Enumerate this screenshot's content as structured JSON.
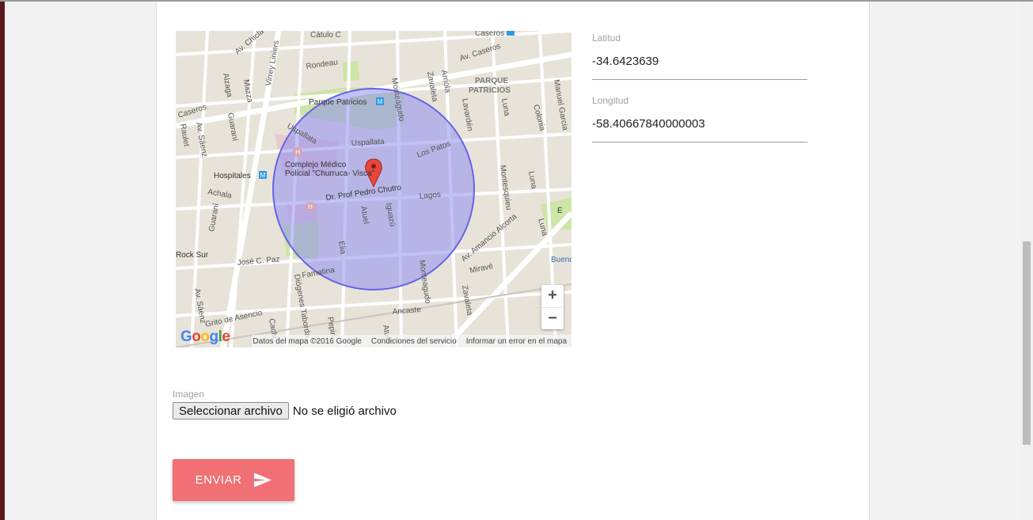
{
  "map": {
    "labels": {
      "caseros_top": "Caseros",
      "av_caseros": "Av. Caseros",
      "caseros_left": "Caseros",
      "parque_patricios_area_1": "PARQUE",
      "parque_patricios_area_2": "PATRICIOS",
      "parque_patricios": "Parque Patricios",
      "catulo": "Cátulo C",
      "av_chiclana": "Av. Chicla",
      "virrey_liniers": "Virrey Liniers",
      "rondeau": "Rondeau",
      "mazza": "Mazza",
      "alzaga": "Alzaga",
      "guarani_1": "Guaraní",
      "av_saenz": "Av. Sáenz",
      "raulet": "Raulet",
      "uspallata_1": "Uspallata",
      "uspallata_2": "Uspallata",
      "monteagudo_1": "Monteagudo",
      "zavaleta_1": "Zavaleta",
      "arriola": "Arriola",
      "lavarden": "Lavardén",
      "luna_1": "Luna",
      "colonia": "Colonia",
      "manuel_garcia": "Manuel Garcia",
      "los_patos": "Los Patos",
      "hospitales": "Hospitales",
      "complejo_1": "Complejo Médico",
      "complejo_2": "Policial \"Churruca- Visca\"",
      "prof_chutro": "Dr. Prof Pedro Chutro",
      "lagos": "Lagos",
      "achala": "Achala",
      "atuel_1": "Atuel",
      "iguazu": "Iguazú",
      "montesquieu": "Montesquieu",
      "luna_2": "Luna",
      "luna_3": "Luna",
      "guarani_2": "Guaraní",
      "av_amancio": "Av. Amancio Alcorta",
      "buenos": "Buenos",
      "rock_sur": "Rock Sur",
      "jose_paz": "José C. Paz",
      "elia": "Elia",
      "famatina": "Famatina",
      "diogenes": "Diógenes Taborda",
      "monteagudo_2": "Monteagudo",
      "mirave": "Miravé",
      "zavaleta_2": "Zavaleta",
      "av_saenz_2": "Av. Sáenz",
      "grito": "Grito de Asencio",
      "cachi": "Cachi",
      "pepiri": "Pepirí",
      "atuel_2": "Atuel",
      "ancaste": "Ancaste",
      "e_label": "E"
    },
    "zoom_in": "+",
    "zoom_out": "−",
    "google": [
      "G",
      "o",
      "o",
      "g",
      "l",
      "e"
    ],
    "footer": {
      "data": "Datos del mapa ©2016 Google",
      "terms": "Condiciones del servicio",
      "report": "Informar un error en el mapa"
    }
  },
  "latitude": {
    "label": "Latitud",
    "value": "-34.6423639"
  },
  "longitude": {
    "label": "Longitud",
    "value": "-58.40667840000003"
  },
  "image": {
    "label": "Imagen",
    "button": "Seleccionar archivo",
    "status": "No se eligió archivo"
  },
  "submit": {
    "label": "ENVIAR",
    "icon": "send-icon"
  },
  "colors": {
    "accent": "#f07075",
    "circle_fill": "#8f8ff0",
    "circle_stroke": "#6464e6",
    "marker": "#e8453c",
    "park": "#cde5a6"
  }
}
